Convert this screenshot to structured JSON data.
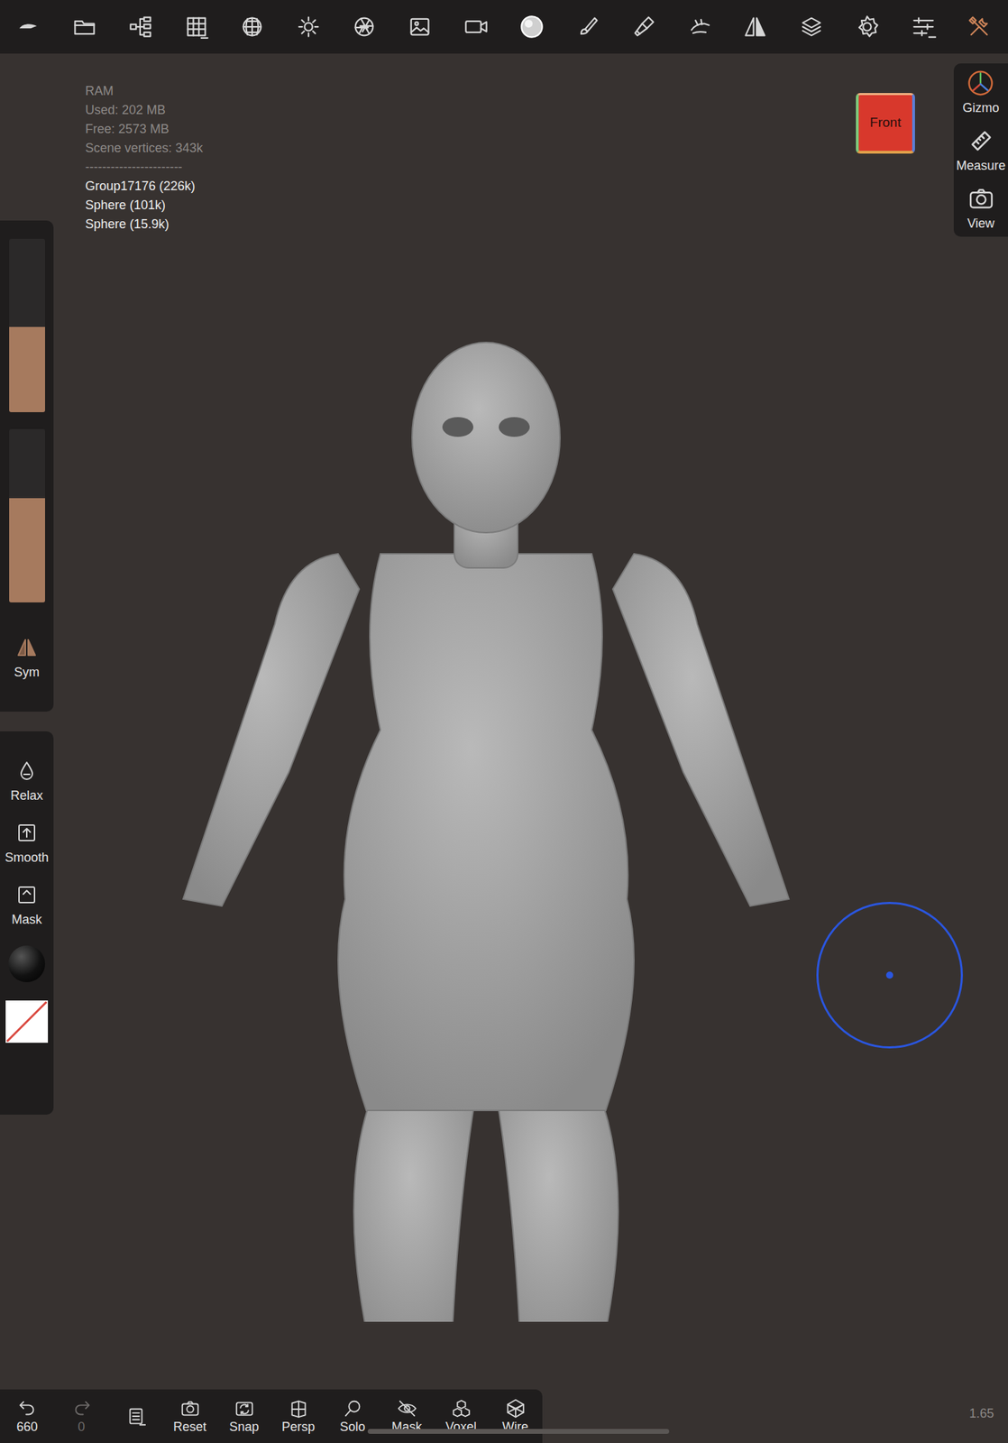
{
  "top_toolbar": [
    {
      "selected": false
    },
    {
      "selected": false
    },
    {
      "selected": false
    },
    {
      "selected": false
    },
    {
      "selected": false
    },
    {
      "selected": false
    },
    {
      "selected": false
    },
    {
      "selected": false
    },
    {
      "selected": false
    },
    {
      "selected": false
    },
    {
      "selected": false
    },
    {
      "selected": false
    },
    {
      "selected": false
    },
    {
      "selected": false
    },
    {
      "selected": false
    },
    {
      "selected": false
    },
    {
      "selected": false
    },
    {
      "selected": true
    }
  ],
  "stats": {
    "lines": [
      "RAM",
      "Used: 202 MB",
      "Free: 2573 MB",
      "Scene vertices: 343k"
    ],
    "separator": "-----------------------",
    "objects": [
      "Group17176 (226k)",
      "Sphere (101k)",
      "Sphere (15.9k)"
    ]
  },
  "sliders": [
    {
      "level": 0.49
    },
    {
      "level": 0.6
    }
  ],
  "symmetry": {
    "label": "Sym"
  },
  "quick_tools": [
    {
      "label": "Relax"
    },
    {
      "label": "Smooth"
    },
    {
      "label": "Mask"
    }
  ],
  "view_cube": {
    "label": "Front"
  },
  "right_panel": [
    {
      "label": "Gizmo"
    },
    {
      "label": "Measure"
    },
    {
      "label": "View"
    }
  ],
  "undo": {
    "count": "660"
  },
  "redo": {
    "count": "0",
    "disabled": true
  },
  "bottom_buttons": [
    {
      "label": "Reset"
    },
    {
      "label": "Snap"
    },
    {
      "label": "Persp"
    },
    {
      "label": "Solo"
    },
    {
      "label": "Mask"
    },
    {
      "label": "Voxel"
    },
    {
      "label": "Wire"
    }
  ],
  "zoom": "1.65"
}
